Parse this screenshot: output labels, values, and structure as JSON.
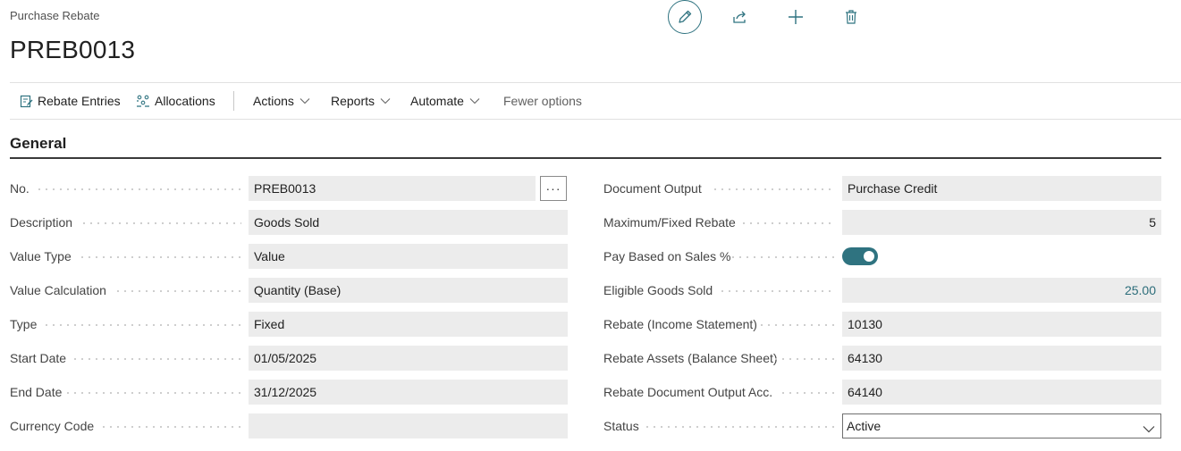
{
  "header": {
    "caption": "Purchase Rebate",
    "title": "PREB0013"
  },
  "top_actions": {
    "icons": [
      "edit-pencil-icon",
      "share-icon",
      "new-plus-icon",
      "delete-trash-icon"
    ]
  },
  "ribbon": {
    "rebate_entries": "Rebate Entries",
    "allocations": "Allocations",
    "actions": "Actions",
    "reports": "Reports",
    "automate": "Automate",
    "fewer_options": "Fewer options"
  },
  "section": {
    "title": "General"
  },
  "left_fields": [
    {
      "label": "No.",
      "value": "PREB0013"
    },
    {
      "label": "Description",
      "value": "Goods Sold"
    },
    {
      "label": "Value Type",
      "value": "Value"
    },
    {
      "label": "Value Calculation",
      "value": "Quantity (Base)"
    },
    {
      "label": "Type",
      "value": "Fixed"
    },
    {
      "label": "Start Date",
      "value": "01/05/2025"
    },
    {
      "label": "End Date",
      "value": "31/12/2025"
    },
    {
      "label": "Currency Code",
      "value": ""
    }
  ],
  "assist_edit_label": "···",
  "right_fields": [
    {
      "label": "Document Output",
      "value": "Purchase Credit"
    },
    {
      "label": "Maximum/Fixed Rebate",
      "value": "5"
    },
    {
      "label": "Pay Based on Sales %",
      "value": true
    },
    {
      "label": "Eligible Goods Sold",
      "value": "25.00"
    },
    {
      "label": "Rebate (Income Statement)",
      "value": "10130"
    },
    {
      "label": "Rebate Assets (Balance Sheet)",
      "value": "64130"
    },
    {
      "label": "Rebate Document Output Acc.",
      "value": "64140"
    },
    {
      "label": "Status",
      "value": "Active"
    }
  ],
  "colors": {
    "accent": "#2f7380",
    "link": "#2c6d7a",
    "field_bg": "#ececec"
  }
}
